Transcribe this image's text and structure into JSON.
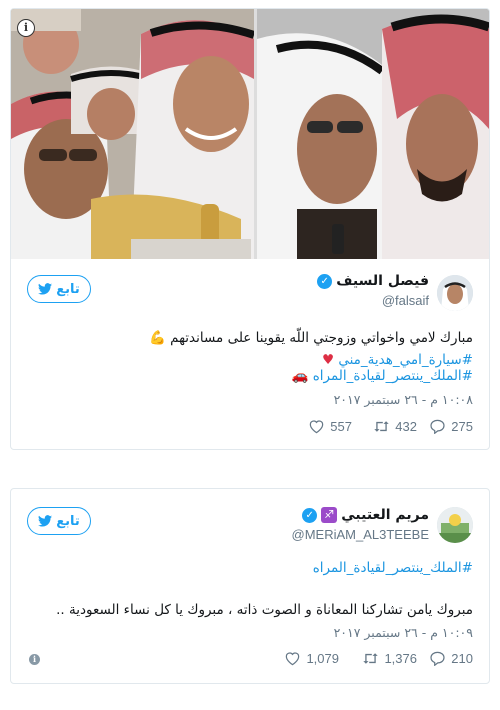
{
  "tweet1": {
    "name": "فيصل السيف",
    "handle": "@falsaif",
    "follow_label": "تابع",
    "text_main": "مبارك لامي واخواتي وزوجتي اللّه يقوينا على مساندتهم",
    "text_tag": "#سيارة_امي_هدية_مني",
    "tag2": "#الملك_ينتصر_لقيادة_المراه",
    "date": "١٠:٠٨ م - ٢٦ سبتمبر ٢٠١٧",
    "replies": "275",
    "retweets": "432",
    "likes": "557"
  },
  "tweet2": {
    "name": "مريم العتيبي",
    "handle": "@MERiAM_AL3TEEBE",
    "follow_label": "تابع",
    "tag": "#الملك_ينتصر_لقيادة_المراه",
    "text": "مبروك يامن تشاركنا المعاناة و الصوت ذاته ، مبروك يا كل نساء السعودية ..",
    "date": "١٠:٠٩ م - ٢٦ سبتمبر ٢٠١٧",
    "replies": "210",
    "retweets": "1,376",
    "likes": "1,079"
  },
  "colors": {
    "accent": "#1da1f2",
    "link": "#1b95e0",
    "muted": "#657786"
  },
  "icons": [
    "info-icon",
    "verified-badge-icon",
    "twitter-bird-icon",
    "reply-icon",
    "retweet-icon",
    "heart-icon",
    "flexed-arm-emoji-icon",
    "red-heart-emoji-icon",
    "car-emoji-icon",
    "zodiac-sagittarius-icon"
  ]
}
